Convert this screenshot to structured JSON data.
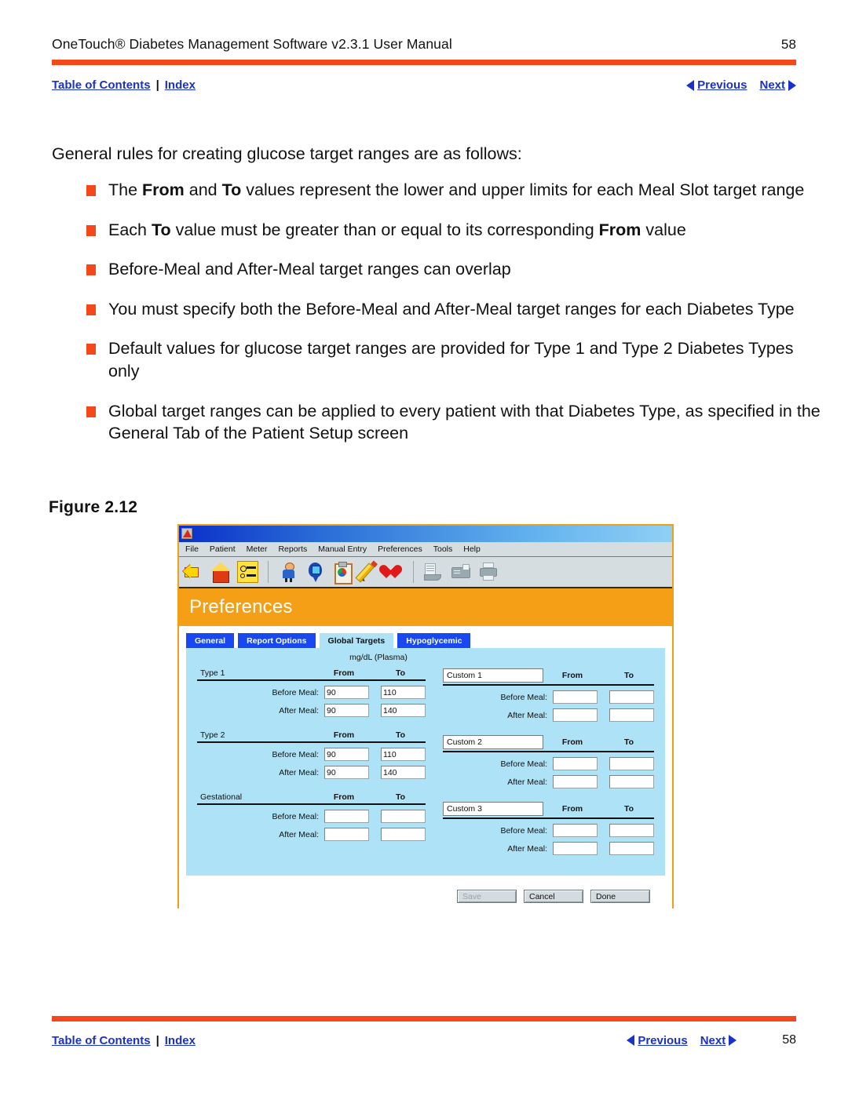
{
  "header": {
    "title": "OneTouch® Diabetes Management Software v2.3.1 User Manual",
    "title_main": "OneTouch",
    "title_rest": " Diabetes Management Software v2.3.1 User Manual",
    "page_number": "58"
  },
  "nav": {
    "toc_label": "Table of Contents",
    "separator": "|",
    "index_label": "Index",
    "previous_label": "Previous",
    "next_label": "Next"
  },
  "content": {
    "intro": "General rules for creating glucose target ranges are as follows:",
    "bullets": [
      {
        "parts": [
          {
            "text": "The ",
            "bold": false
          },
          {
            "text": "From",
            "bold": true
          },
          {
            "text": " and ",
            "bold": false
          },
          {
            "text": "To",
            "bold": true
          },
          {
            "text": " values represent the lower and upper limits for each Meal Slot target range",
            "bold": false
          }
        ]
      },
      {
        "parts": [
          {
            "text": "Each ",
            "bold": false
          },
          {
            "text": "To",
            "bold": true
          },
          {
            "text": " value must be greater than or equal to its corresponding ",
            "bold": false
          },
          {
            "text": "From",
            "bold": true
          },
          {
            "text": " value",
            "bold": false
          }
        ]
      },
      {
        "parts": [
          {
            "text": "Before-Meal and After-Meal target ranges can overlap",
            "bold": false
          }
        ]
      },
      {
        "parts": [
          {
            "text": "You must specify both the Before-Meal and After-Meal target ranges for each Diabetes Type",
            "bold": false
          }
        ]
      },
      {
        "parts": [
          {
            "text": "Default values for glucose target ranges are provided for Type 1 and Type 2 Diabetes Types only",
            "bold": false
          }
        ]
      },
      {
        "parts": [
          {
            "text": "Global target ranges can be applied to every patient with that Diabetes Type, as specified in the General Tab of the Patient Setup screen",
            "bold": false
          }
        ]
      }
    ],
    "figure_caption": "Figure 2.12"
  },
  "app": {
    "menu_items": [
      "File",
      "Patient",
      "Meter",
      "Reports",
      "Manual Entry",
      "Preferences",
      "Tools",
      "Help"
    ],
    "toolbar_icons": [
      {
        "name": "back-arrow-icon",
        "enabled": true
      },
      {
        "name": "home-house-icon",
        "enabled": true
      },
      {
        "name": "patient-list-icon",
        "enabled": true
      },
      {
        "name": "person-icon",
        "enabled": true
      },
      {
        "name": "glucose-meter-icon",
        "enabled": true
      },
      {
        "name": "reports-clipboard-icon",
        "enabled": true
      },
      {
        "name": "manual-entry-pencil-icon",
        "enabled": true
      },
      {
        "name": "heart-icon",
        "enabled": true
      },
      {
        "name": "fax-icon",
        "enabled": false
      },
      {
        "name": "card-reader-icon",
        "enabled": false
      },
      {
        "name": "printer-icon",
        "enabled": false
      }
    ],
    "screen_title": "Preferences",
    "tabs": [
      {
        "label": "General",
        "active": false
      },
      {
        "label": "Report Options",
        "active": false
      },
      {
        "label": "Global Targets",
        "active": true
      },
      {
        "label": "Hypoglycemic",
        "active": false
      }
    ],
    "units_label": "mg/dL (Plasma)",
    "col_from": "From",
    "col_to": "To",
    "row_before_meal": "Before Meal:",
    "row_after_meal": "After Meal:",
    "groups_left": [
      {
        "title": "Type 1",
        "editable_title": false,
        "before_from": "90",
        "before_to": "110",
        "after_from": "90",
        "after_to": "140"
      },
      {
        "title": "Type 2",
        "editable_title": false,
        "before_from": "90",
        "before_to": "110",
        "after_from": "90",
        "after_to": "140"
      },
      {
        "title": "Gestational",
        "editable_title": false,
        "before_from": "",
        "before_to": "",
        "after_from": "",
        "after_to": ""
      }
    ],
    "groups_right": [
      {
        "title": "Custom 1",
        "editable_title": true,
        "before_from": "",
        "before_to": "",
        "after_from": "",
        "after_to": ""
      },
      {
        "title": "Custom 2",
        "editable_title": true,
        "before_from": "",
        "before_to": "",
        "after_from": "",
        "after_to": ""
      },
      {
        "title": "Custom 3",
        "editable_title": true,
        "before_from": "",
        "before_to": "",
        "after_from": "",
        "after_to": ""
      }
    ],
    "buttons": [
      {
        "label": "Save",
        "disabled": true
      },
      {
        "label": "Cancel",
        "disabled": false
      },
      {
        "label": "Done",
        "disabled": false
      }
    ]
  },
  "colors": {
    "accent_rule": "#f4481a",
    "link": "#1a32c8",
    "app_header_orange": "#f59f16",
    "tab_blue": "#1a48f0",
    "panel_blue": "#aee3f7",
    "figure_border": "#f0a018"
  }
}
